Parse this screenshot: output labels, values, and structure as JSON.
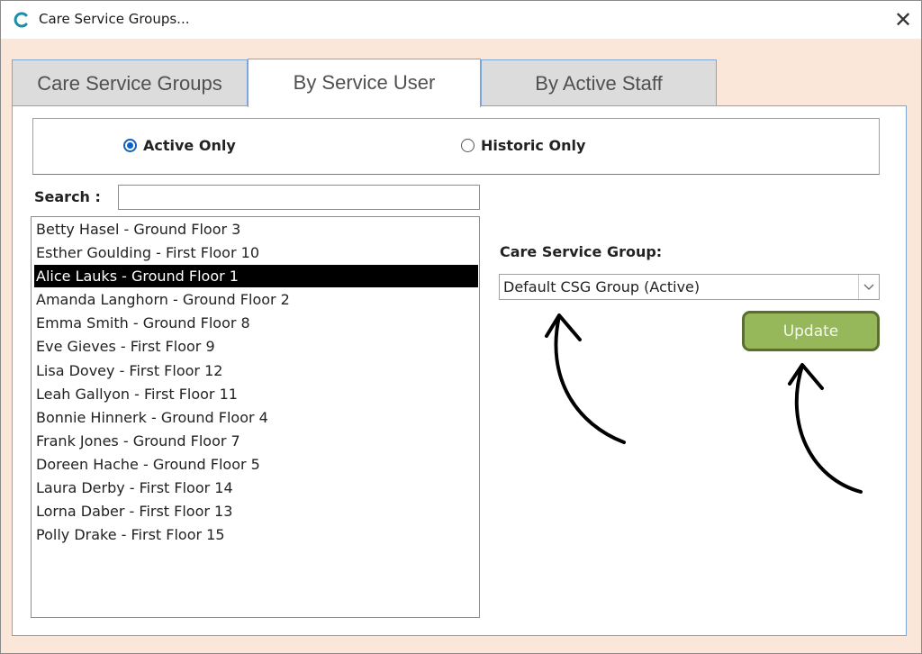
{
  "window": {
    "title": "Care Service Groups...",
    "app_icon": "app-logo-icon",
    "close_icon": "close-icon",
    "close_glyph": "✕"
  },
  "tabs": [
    {
      "label": "Care Service Groups",
      "active": false
    },
    {
      "label": "By Service User",
      "active": true
    },
    {
      "label": "By Active Staff",
      "active": false
    }
  ],
  "filter": {
    "options": [
      {
        "label": "Active Only",
        "checked": true
      },
      {
        "label": "Historic Only",
        "checked": false
      }
    ]
  },
  "search": {
    "label": "Search :",
    "value": ""
  },
  "service_users": [
    {
      "label": "Betty Hasel - Ground Floor 3",
      "selected": false
    },
    {
      "label": "Esther Goulding - First Floor 10",
      "selected": false
    },
    {
      "label": "Alice Lauks - Ground Floor 1",
      "selected": true
    },
    {
      "label": "Amanda Langhorn - Ground Floor 2",
      "selected": false
    },
    {
      "label": "Emma Smith - Ground Floor 8",
      "selected": false
    },
    {
      "label": "Eve Gieves - First Floor 9",
      "selected": false
    },
    {
      "label": "Lisa Dovey - First Floor 12",
      "selected": false
    },
    {
      "label": "Leah Gallyon - First Floor 11",
      "selected": false
    },
    {
      "label": "Bonnie Hinnerk - Ground Floor 4",
      "selected": false
    },
    {
      "label": "Frank Jones - Ground Floor 7",
      "selected": false
    },
    {
      "label": "Doreen Hache - Ground Floor 5",
      "selected": false
    },
    {
      "label": "Laura Derby - First Floor 14",
      "selected": false
    },
    {
      "label": "Lorna Daber - First Floor 13",
      "selected": false
    },
    {
      "label": "Polly Drake - First Floor 15",
      "selected": false
    }
  ],
  "care_service_group": {
    "label": "Care Service Group:",
    "selected": "Default CSG Group (Active)",
    "dropdown_icon": "chevron-down-icon"
  },
  "update_button": {
    "label": "Update"
  },
  "colors": {
    "window_bg": "#fbe7da",
    "tab_border": "#7aa7d8",
    "radio_accent": "#0a64c8",
    "update_bg": "#96b85a",
    "update_border": "#5a6e32",
    "selected_row": "#000000"
  }
}
